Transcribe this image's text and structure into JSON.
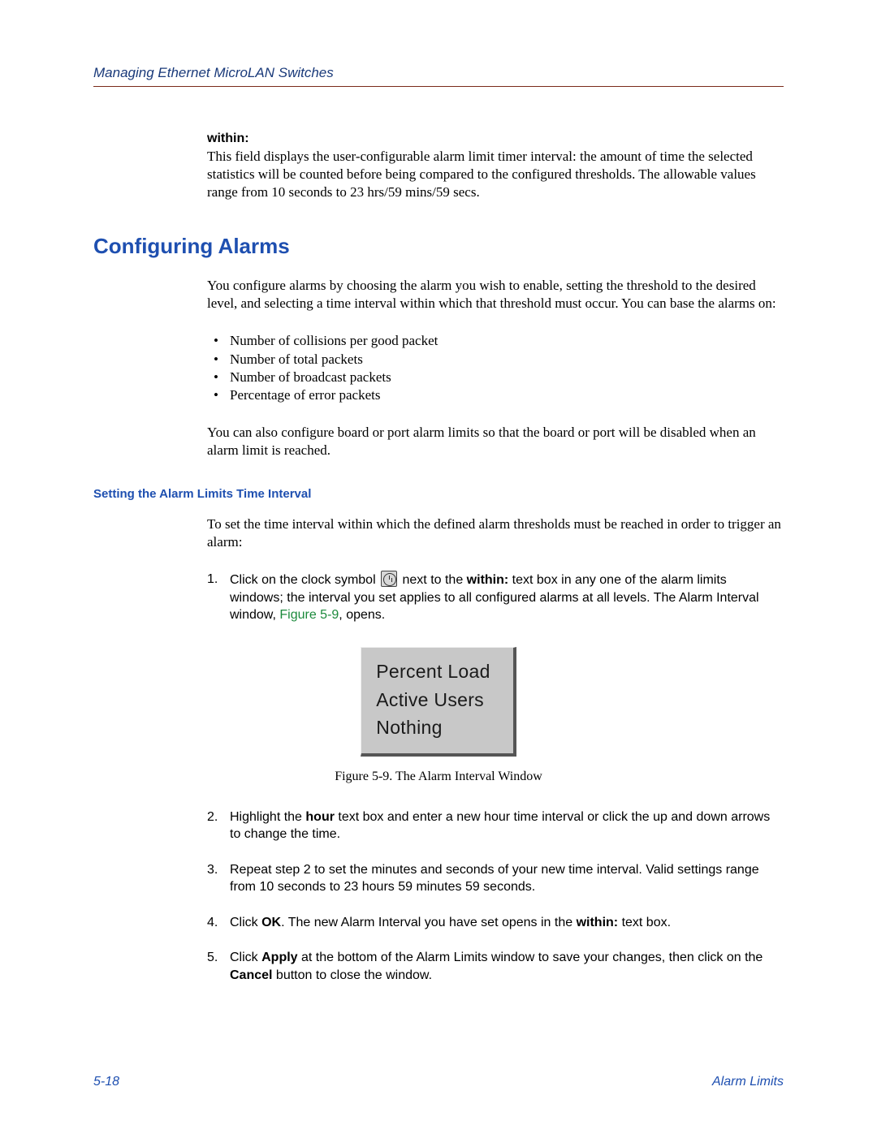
{
  "header": {
    "running_title": "Managing Ethernet MicroLAN Switches"
  },
  "within_block": {
    "label": "within:",
    "text": "This field displays the user-configurable alarm limit timer interval: the amount of time the selected statistics will be counted before being compared to the configured thresholds. The allowable values range from 10 seconds to 23 hrs/59 mins/59 secs."
  },
  "section": {
    "title": "Configuring Alarms",
    "intro": "You configure alarms by choosing the alarm you wish to enable, setting the threshold to the desired level, and selecting a time interval within which that threshold must occur. You can base the alarms on:",
    "bullets": [
      "Number of collisions per good packet",
      "Number of total packets",
      "Number of broadcast packets",
      "Percentage of error packets"
    ],
    "after_bullets": "You can also configure board or port alarm limits so that the board or port will be disabled when an alarm limit is reached."
  },
  "subsection": {
    "title": "Setting the Alarm Limits Time Interval",
    "intro": "To set the time interval within which the defined alarm thresholds must be reached in order to trigger an alarm:",
    "steps": [
      {
        "num": "1.",
        "pre": "Click on the clock symbol ",
        "post1": " next to the ",
        "bold1": "within:",
        "post2": " text box in any one of the alarm limits windows; the interval you set applies to all configured alarms at all levels. The Alarm Interval window, ",
        "link": "Figure 5-9",
        "post3": ", opens."
      },
      {
        "num": "2.",
        "pre": "Highlight the ",
        "bold1": "hour",
        "post1": " text box and enter a new hour time interval or click the up and down arrows to change the time."
      },
      {
        "num": "3.",
        "text": "Repeat step 2 to set the minutes and seconds of your new time interval. Valid settings range from 10 seconds to 23 hours 59 minutes 59 seconds."
      },
      {
        "num": "4.",
        "pre": "Click ",
        "bold1": "OK",
        "post1": ". The new Alarm Interval you have set opens in the ",
        "bold2": "within:",
        "post2": " text box."
      },
      {
        "num": "5.",
        "pre": "Click ",
        "bold1": "Apply",
        "post1": " at the bottom of the Alarm Limits window to save your changes, then click on the ",
        "bold2": "Cancel",
        "post2": " button to close the window."
      }
    ]
  },
  "figure": {
    "items": [
      "Percent Load",
      "Active Users",
      "Nothing"
    ],
    "caption": "Figure 5-9. The Alarm Interval Window"
  },
  "footer": {
    "page": "5-18",
    "section": "Alarm Limits"
  }
}
